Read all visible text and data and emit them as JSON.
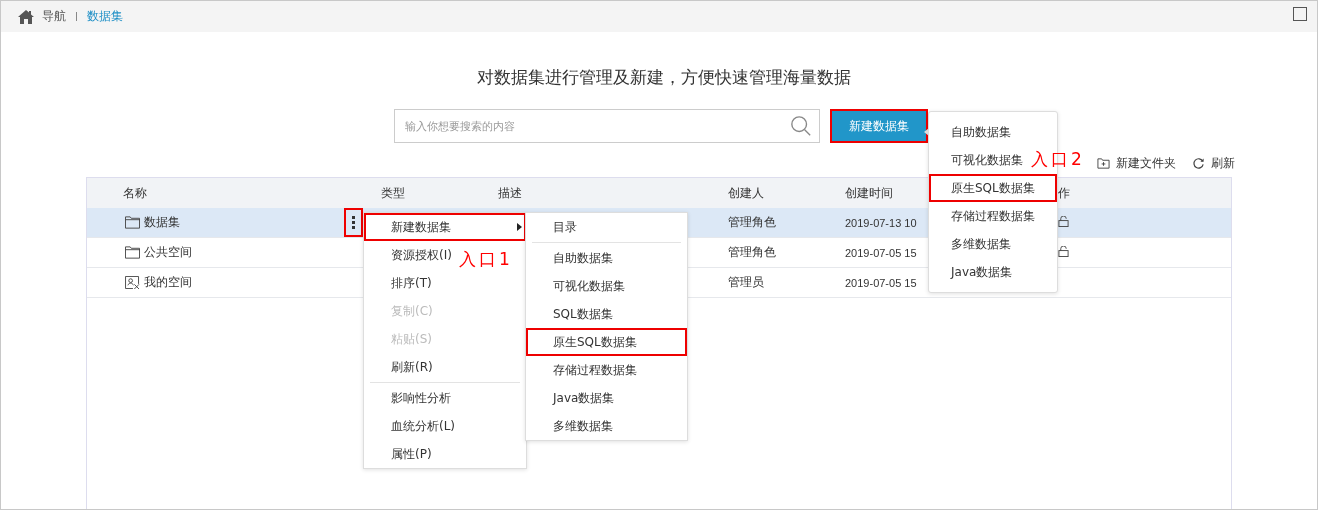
{
  "breadcrumb": [
    {
      "label": "导航",
      "selected": false
    },
    {
      "label": "数据集",
      "selected": true
    }
  ],
  "headline": "对数据集进行管理及新建，方便快速管理海量数据",
  "search": {
    "placeholder": "输入你想要搜索的内容"
  },
  "new_button": {
    "label": "新建数据集",
    "highlighted": true
  },
  "toolbar": [
    {
      "kind": "folder",
      "label": "新建文件夹"
    },
    {
      "kind": "refresh",
      "label": "刷新"
    }
  ],
  "table": {
    "columns": [
      "名称",
      "类型",
      "描述",
      "创建人",
      "创建时间",
      "作"
    ],
    "rows": [
      {
        "kind": "folder",
        "name": "数据集",
        "creator": "管理角色",
        "time": "2019-07-13 10",
        "selected": true,
        "action": true
      },
      {
        "kind": "folder",
        "name": "公共空间",
        "creator": "管理角色",
        "time": "2019-07-05 15",
        "selected": false,
        "action": true
      },
      {
        "kind": "user",
        "name": "我的空间",
        "creator": "管理员",
        "time": "2019-07-05 15",
        "selected": false,
        "action": false
      }
    ],
    "more_button": {
      "highlighted": true
    }
  },
  "context_menu": {
    "items": [
      {
        "label": "新建数据集",
        "disabled": false,
        "highlighted": true,
        "submenu": true,
        "divider": false
      },
      {
        "label": "资源授权(I)",
        "disabled": false,
        "highlighted": false,
        "submenu": false,
        "divider": false
      },
      {
        "label": "排序(T)",
        "disabled": false,
        "highlighted": false,
        "submenu": false,
        "divider": false
      },
      {
        "label": "复制(C)",
        "disabled": true,
        "highlighted": false,
        "submenu": false,
        "divider": false
      },
      {
        "label": "粘贴(S)",
        "disabled": true,
        "highlighted": false,
        "submenu": false,
        "divider": false
      },
      {
        "label": "刷新(R)",
        "disabled": false,
        "highlighted": false,
        "submenu": false,
        "divider": true
      },
      {
        "label": "影响性分析",
        "disabled": false,
        "highlighted": false,
        "submenu": false,
        "divider": false
      },
      {
        "label": "血统分析(L)",
        "disabled": false,
        "highlighted": false,
        "submenu": false,
        "divider": false
      },
      {
        "label": "属性(P)",
        "disabled": false,
        "highlighted": false,
        "submenu": false,
        "divider": false
      }
    ]
  },
  "submenu": {
    "items": [
      {
        "label": "目录",
        "highlighted": false,
        "divider": true
      },
      {
        "label": "自助数据集",
        "highlighted": false,
        "divider": false
      },
      {
        "label": "可视化数据集",
        "highlighted": false,
        "divider": false
      },
      {
        "label": "SQL数据集",
        "highlighted": false,
        "divider": false
      },
      {
        "label": "原生SQL数据集",
        "highlighted": true,
        "divider": false
      },
      {
        "label": "存储过程数据集",
        "highlighted": false,
        "divider": false
      },
      {
        "label": "Java数据集",
        "highlighted": false,
        "divider": false
      },
      {
        "label": "多维数据集",
        "highlighted": false,
        "divider": false
      }
    ]
  },
  "dropdown": {
    "items": [
      {
        "label": "自助数据集",
        "highlighted": false
      },
      {
        "label": "可视化数据集",
        "highlighted": false
      },
      {
        "label": "原生SQL数据集",
        "highlighted": true
      },
      {
        "label": "存储过程数据集",
        "highlighted": false
      },
      {
        "label": "多维数据集",
        "highlighted": false
      },
      {
        "label": "Java数据集",
        "highlighted": false
      }
    ]
  },
  "annotations": [
    "入口1",
    "入口2"
  ]
}
